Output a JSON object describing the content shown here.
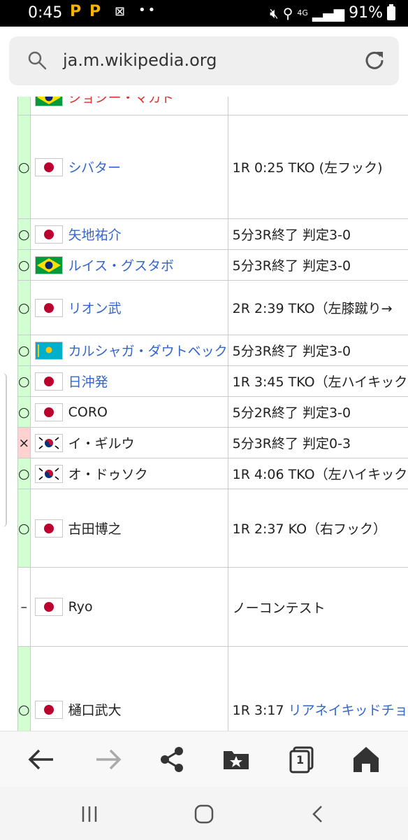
{
  "status_bar": {
    "time": "0:45",
    "battery": "91%",
    "network": "4G",
    "app_p": "P",
    "dots": "••"
  },
  "browser": {
    "url": "ja.m.wikipedia.org"
  },
  "table": {
    "rows": [
      {
        "result": "",
        "flag": "brazil",
        "opponent": "ジョシー・マカド",
        "opponent_style": "red",
        "method": "",
        "height": 52
      },
      {
        "result": "○",
        "result_type": "win",
        "flag": "japan",
        "opponent": "シバター",
        "opponent_style": "link",
        "method": "1R 0:25 TKO (左フック)",
        "height": 148
      },
      {
        "result": "○",
        "result_type": "win",
        "flag": "japan",
        "opponent": "矢地祐介",
        "opponent_style": "link",
        "method": "5分3R終了 判定3-0",
        "height": 44
      },
      {
        "result": "○",
        "result_type": "win",
        "flag": "brazil",
        "opponent": "ルイス・グスタボ",
        "opponent_style": "link",
        "method": "5分3R終了 判定3-0",
        "height": 44
      },
      {
        "result": "○",
        "result_type": "win",
        "flag": "japan",
        "opponent": "リオン武",
        "opponent_style": "link",
        "method": "2R 2:39 TKO（左膝蹴り→",
        "height": 78
      },
      {
        "result": "○",
        "result_type": "win",
        "flag": "kazakhstan",
        "opponent": "カルシャガ・ダウトベック",
        "opponent_style": "link",
        "method": "5分3R終了 判定3-0",
        "height": 44
      },
      {
        "result": "○",
        "result_type": "win",
        "flag": "japan",
        "opponent": "日沖発",
        "opponent_style": "link",
        "method": "1R 3:45 TKO（左ハイキック",
        "height": 44
      },
      {
        "result": "○",
        "result_type": "win",
        "flag": "japan",
        "opponent": "CORO",
        "opponent_style": "plain",
        "method": "5分2R終了 判定3-0",
        "height": 44
      },
      {
        "result": "×",
        "result_type": "loss",
        "flag": "korea",
        "opponent": "イ・ギルウ",
        "opponent_style": "plain",
        "method": "5分3R終了 判定0-3",
        "height": 44
      },
      {
        "result": "○",
        "result_type": "win",
        "flag": "korea",
        "opponent": "オ・ドゥソク",
        "opponent_style": "plain",
        "method": "1R 4:06 TKO（左ハイキック",
        "height": 44
      },
      {
        "result": "○",
        "result_type": "win",
        "flag": "japan",
        "opponent": "古田博之",
        "opponent_style": "plain",
        "method": "1R 2:37 KO（右フック）",
        "height": 112
      },
      {
        "result": "–",
        "result_type": "nc",
        "flag": "japan",
        "opponent": "Ryo",
        "opponent_style": "plain",
        "method": "ノーコンテスト",
        "height": 113
      },
      {
        "result": "○",
        "result_type": "win",
        "flag": "japan",
        "opponent": "樋口武大",
        "opponent_style": "plain",
        "method_prefix": "1R 3:17 ",
        "method_link": "リアネイキッドチョーク",
        "height": 180
      }
    ]
  },
  "toolbar": {
    "back": "back-arrow-icon",
    "forward": "forward-arrow-icon",
    "share": "share-icon",
    "bookmarks": "bookmark-star-icon",
    "tabs_count": "1",
    "home": "home-icon"
  }
}
